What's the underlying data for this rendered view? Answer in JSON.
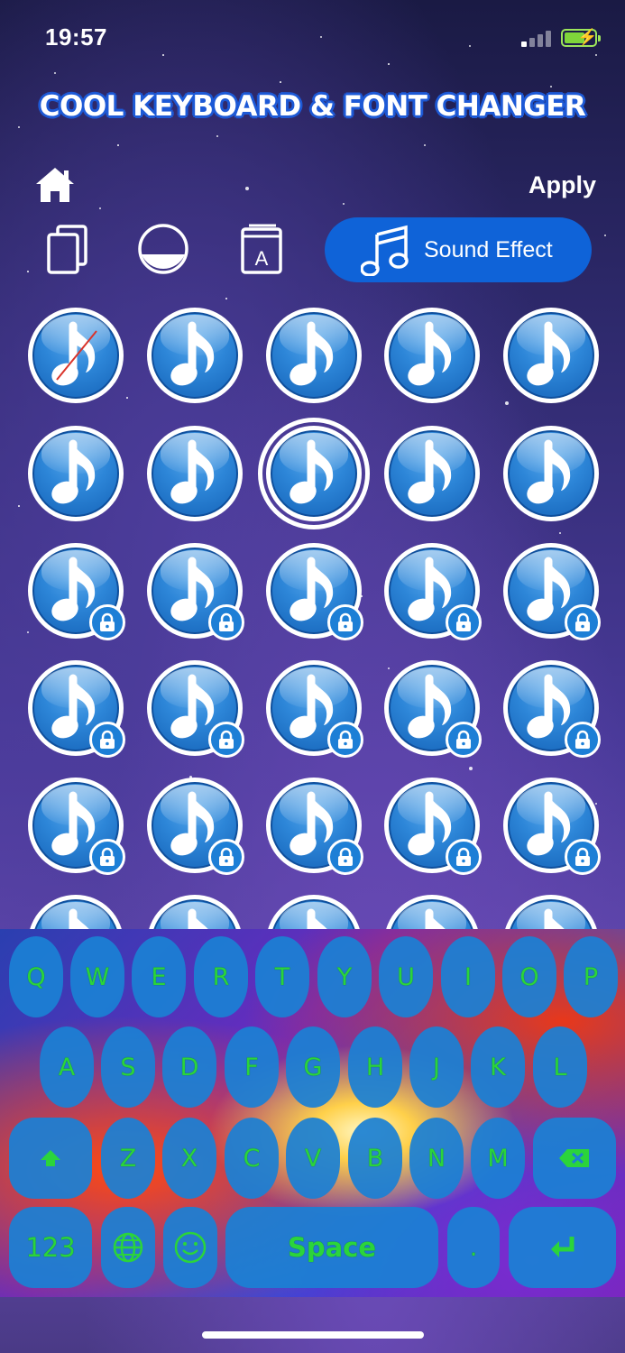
{
  "status_bar": {
    "time": "19:57"
  },
  "header": {
    "title": "COOL KEYBOARD & FONT CHANGER",
    "apply_label": "Apply"
  },
  "tabs": {
    "active_label": "Sound Effect"
  },
  "sound_grid": {
    "columns": 5,
    "locked_from_row": 3,
    "selected_index": 7,
    "muted_index": 0
  },
  "keyboard": {
    "rows": [
      [
        "Q",
        "W",
        "E",
        "R",
        "T",
        "Y",
        "U",
        "I",
        "O",
        "P"
      ],
      [
        "A",
        "S",
        "D",
        "F",
        "G",
        "H",
        "J",
        "K",
        "L"
      ],
      [
        "Z",
        "X",
        "C",
        "V",
        "B",
        "N",
        "M"
      ]
    ],
    "numbers_label": "123",
    "space_label": "Space",
    "period_label": ".",
    "key_text_color": "#2bd43b",
    "key_color": "#1b80d4"
  },
  "colors": {
    "accent": "#0f63d8",
    "title_outline": "#1e5ad6"
  }
}
